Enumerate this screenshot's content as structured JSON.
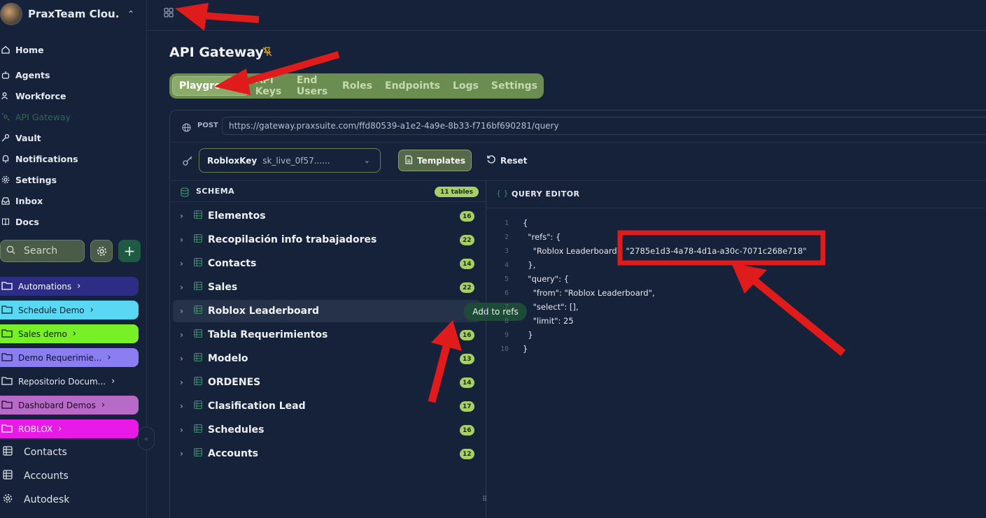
{
  "workspace": {
    "name": "PraxTeam Clou..."
  },
  "nav": [
    {
      "label": "Home",
      "icon": "home-icon"
    },
    {
      "label": "Agents",
      "icon": "bot-icon"
    },
    {
      "label": "Workforce",
      "icon": "users-icon"
    },
    {
      "label": "API Gateway",
      "icon": "gateway-icon"
    },
    {
      "label": "Vault",
      "icon": "key-icon"
    },
    {
      "label": "Notifications",
      "icon": "bell-icon"
    },
    {
      "label": "Settings",
      "icon": "gear-icon"
    },
    {
      "label": "Inbox",
      "icon": "inbox-icon"
    },
    {
      "label": "Docs",
      "icon": "docs-icon"
    }
  ],
  "search": {
    "placeholder": "Search"
  },
  "folders": [
    {
      "label": "Automations",
      "color": "#2d2d86",
      "text": "#ffffff"
    },
    {
      "label": "Schedule Demo",
      "color": "#5ad7f2",
      "text": "#10202a"
    },
    {
      "label": "Sales demo",
      "color": "#78f028",
      "text": "#10200a"
    },
    {
      "label": "Demo Requerimie...",
      "color": "#8a7ef0",
      "text": "#10102a"
    },
    {
      "label": "Repositorio Docum...",
      "color": "",
      "text": "#e6e9ef"
    },
    {
      "label": "Dashobard Demos",
      "color": "#b86ac8",
      "text": "#1a0a20"
    },
    {
      "label": "ROBLOX",
      "color": "#e81ae8",
      "text": "#ffffff"
    }
  ],
  "table_links": [
    {
      "label": "Contacts"
    },
    {
      "label": "Accounts"
    },
    {
      "label": "Autodesk"
    }
  ],
  "page": {
    "title": "API Gateway"
  },
  "tabs": [
    "Playground",
    "API Keys",
    "End Users",
    "Roles",
    "Endpoints",
    "Logs",
    "Settings"
  ],
  "request": {
    "method": "POST",
    "url": "https://gateway.praxsuite.com/ffd80539-a1e2-4a9e-8b33-f716bf690281/query"
  },
  "key_select": {
    "name": "RobloxKey",
    "value": "sk_live_0f57......"
  },
  "buttons": {
    "templates": "Templates",
    "reset": "Reset"
  },
  "schema": {
    "label": "SCHEMA",
    "count": "11 tables",
    "tables": [
      {
        "name": "Elementos",
        "count": "16"
      },
      {
        "name": "Recopilación info trabajadores",
        "count": "22"
      },
      {
        "name": "Contacts",
        "count": "14"
      },
      {
        "name": "Sales",
        "count": "22"
      },
      {
        "name": "Roblox Leaderboard",
        "count": ""
      },
      {
        "name": "Tabla Requerimientos",
        "count": "16"
      },
      {
        "name": "Modelo",
        "count": "13"
      },
      {
        "name": "ORDENES",
        "count": "14"
      },
      {
        "name": "Clasification Lead",
        "count": "17"
      },
      {
        "name": "Schedules",
        "count": "16"
      },
      {
        "name": "Accounts",
        "count": "12"
      }
    ],
    "tooltip": "Add to refs"
  },
  "query_editor": {
    "label": "QUERY EDITOR",
    "lines": [
      "{",
      "  \"refs\": {",
      "    \"Roblox Leaderboard\": \"2785e1d3-4a78-4d1a-a30c-7071c268e718\"",
      "  },",
      "  \"query\": {",
      "    \"from\": \"Roblox Leaderboard\",",
      "    \"select\": [],",
      "    \"limit\": 25",
      "  }",
      "}"
    ],
    "line_numbers": [
      "1",
      "2",
      "3",
      "4",
      "5",
      "6",
      "7",
      "8",
      "9",
      "10"
    ]
  },
  "colors": {
    "accent": "#6b8d51",
    "badge": "#a6d066",
    "annotation": "#e01b1b"
  }
}
